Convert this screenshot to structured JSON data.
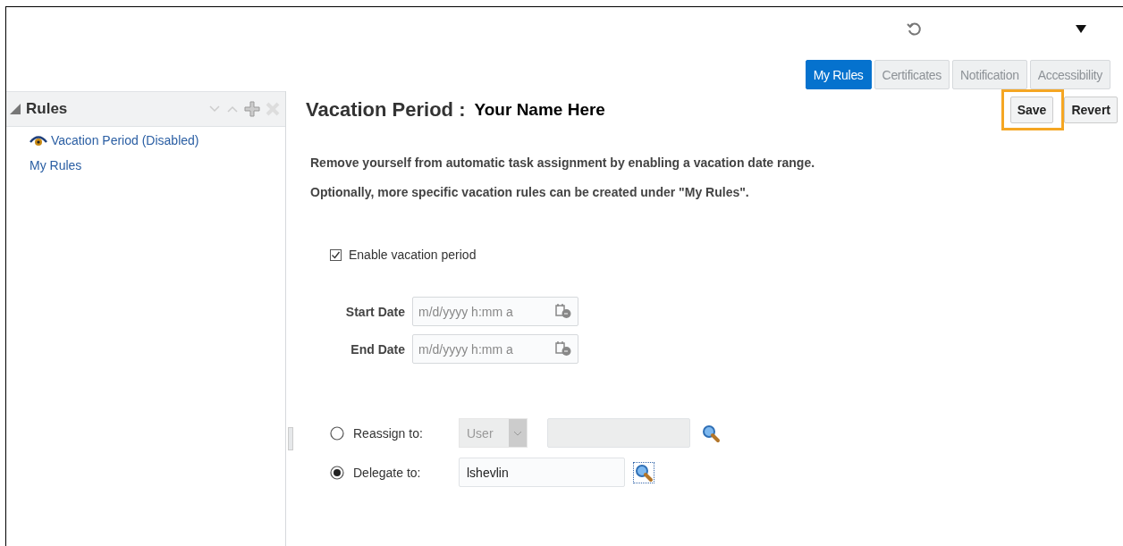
{
  "tabs": [
    {
      "label": "My Rules",
      "selected": true
    },
    {
      "label": "Certificates",
      "selected": false
    },
    {
      "label": "Notification",
      "selected": false
    },
    {
      "label": "Accessibility",
      "selected": false
    }
  ],
  "sidebar": {
    "title": "Rules",
    "expanded": true,
    "items": [
      {
        "label": "Vacation Period (Disabled)",
        "kind": "vacation"
      },
      {
        "label": "My Rules",
        "kind": "plain"
      }
    ]
  },
  "header": {
    "title": "Vacation Period :",
    "name": "Your Name Here"
  },
  "buttons": [
    {
      "label": "Save",
      "highlighted": true
    },
    {
      "label": "Revert"
    }
  ],
  "description": [
    "Remove yourself from automatic task assignment by enabling a vacation date range.",
    "Optionally, more specific vacation rules can be created under \"My Rules\"."
  ],
  "enable_checkbox": {
    "label": "Enable vacation period",
    "checked": true
  },
  "dates": [
    {
      "label": "Start Date",
      "placeholder": "m/d/yyyy h:mm a"
    },
    {
      "label": "End Date",
      "placeholder": "m/d/yyyy h:mm a"
    }
  ],
  "assign_options": [
    {
      "label": "Reassign to:",
      "selected": false,
      "disabled": true,
      "type_select": "User"
    },
    {
      "label": "Delegate to:",
      "selected": true,
      "disabled": false,
      "value": "lshevlin"
    }
  ]
}
